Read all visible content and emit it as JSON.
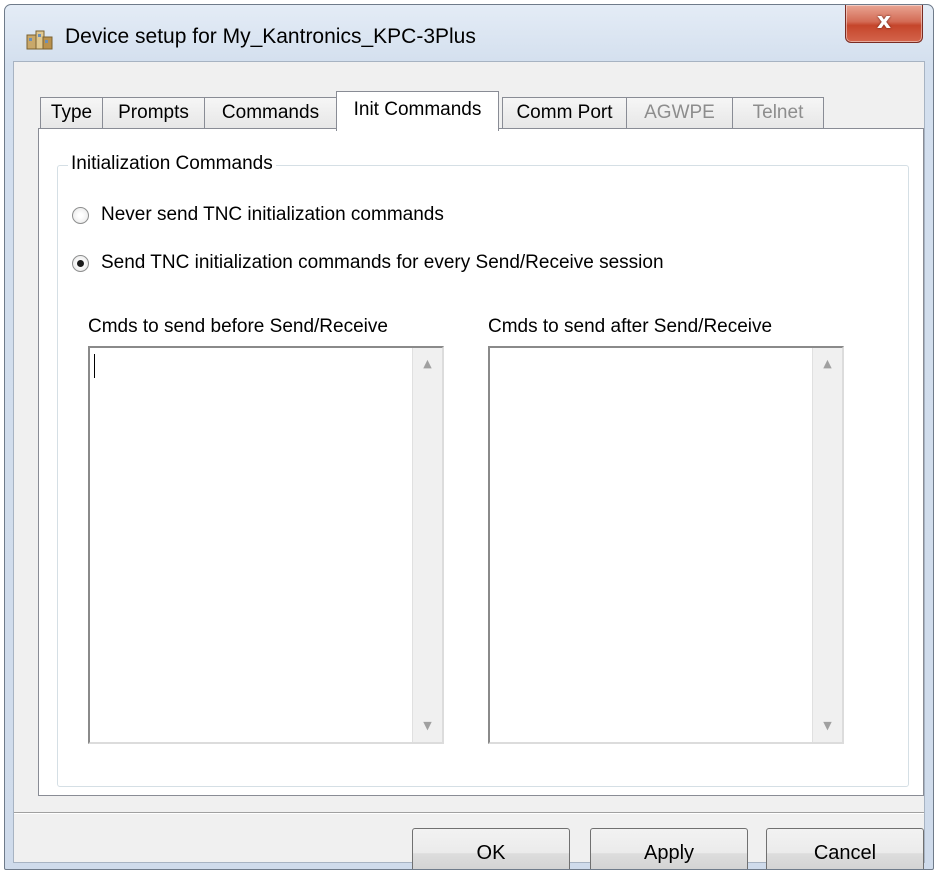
{
  "window": {
    "title": "Device setup for My_Kantronics_KPC-3Plus",
    "close_label": "x"
  },
  "tabs": [
    {
      "label": "Type",
      "state": "normal"
    },
    {
      "label": "Prompts",
      "state": "normal"
    },
    {
      "label": "Commands",
      "state": "normal"
    },
    {
      "label": "Init Commands",
      "state": "active"
    },
    {
      "label": "Comm Port",
      "state": "normal"
    },
    {
      "label": "AGWPE",
      "state": "disabled"
    },
    {
      "label": "Telnet",
      "state": "disabled"
    }
  ],
  "init_group": {
    "legend": "Initialization Commands",
    "radio_never": {
      "label": "Never send TNC initialization commands",
      "checked": false
    },
    "radio_every": {
      "label": "Send TNC initialization commands for every Send/Receive session",
      "checked": true
    },
    "before_label": "Cmds to send before Send/Receive",
    "before_value": "",
    "after_label": "Cmds to send after Send/Receive",
    "after_value": ""
  },
  "buttons": {
    "ok": "OK",
    "apply": "Apply",
    "cancel": "Cancel"
  },
  "icons": {
    "app": "device-setup-icon",
    "close": "close-icon",
    "scroll_up": "scroll-up-arrow-icon",
    "scroll_down": "scroll-down-arrow-icon"
  },
  "colors": {
    "close_button": "#c5452b",
    "disabled_text": "#8d8d8d"
  }
}
